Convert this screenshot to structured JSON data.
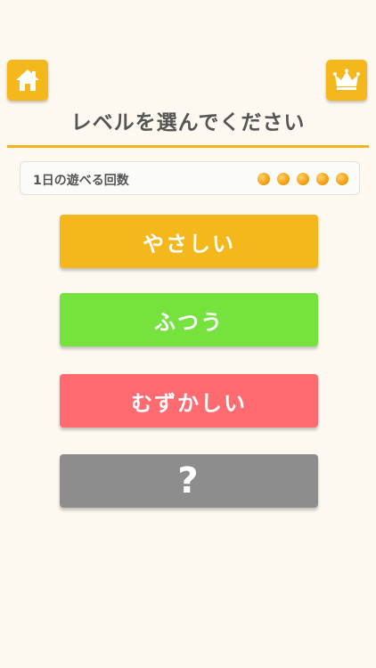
{
  "header": {
    "home_icon": "home-icon",
    "crown_icon": "crown-icon",
    "title": "レベルを選んでください"
  },
  "plays": {
    "label": "1日の遊べる回数",
    "remaining": 5,
    "dot_color": "#f5a31b"
  },
  "levels": [
    {
      "label": "やさしい",
      "color": "#f4b81c"
    },
    {
      "label": "ふつう",
      "color": "#75e23e"
    },
    {
      "label": "むずかしい",
      "color": "#ff6b70"
    },
    {
      "label": "?",
      "color": "#8d8d8d"
    }
  ]
}
